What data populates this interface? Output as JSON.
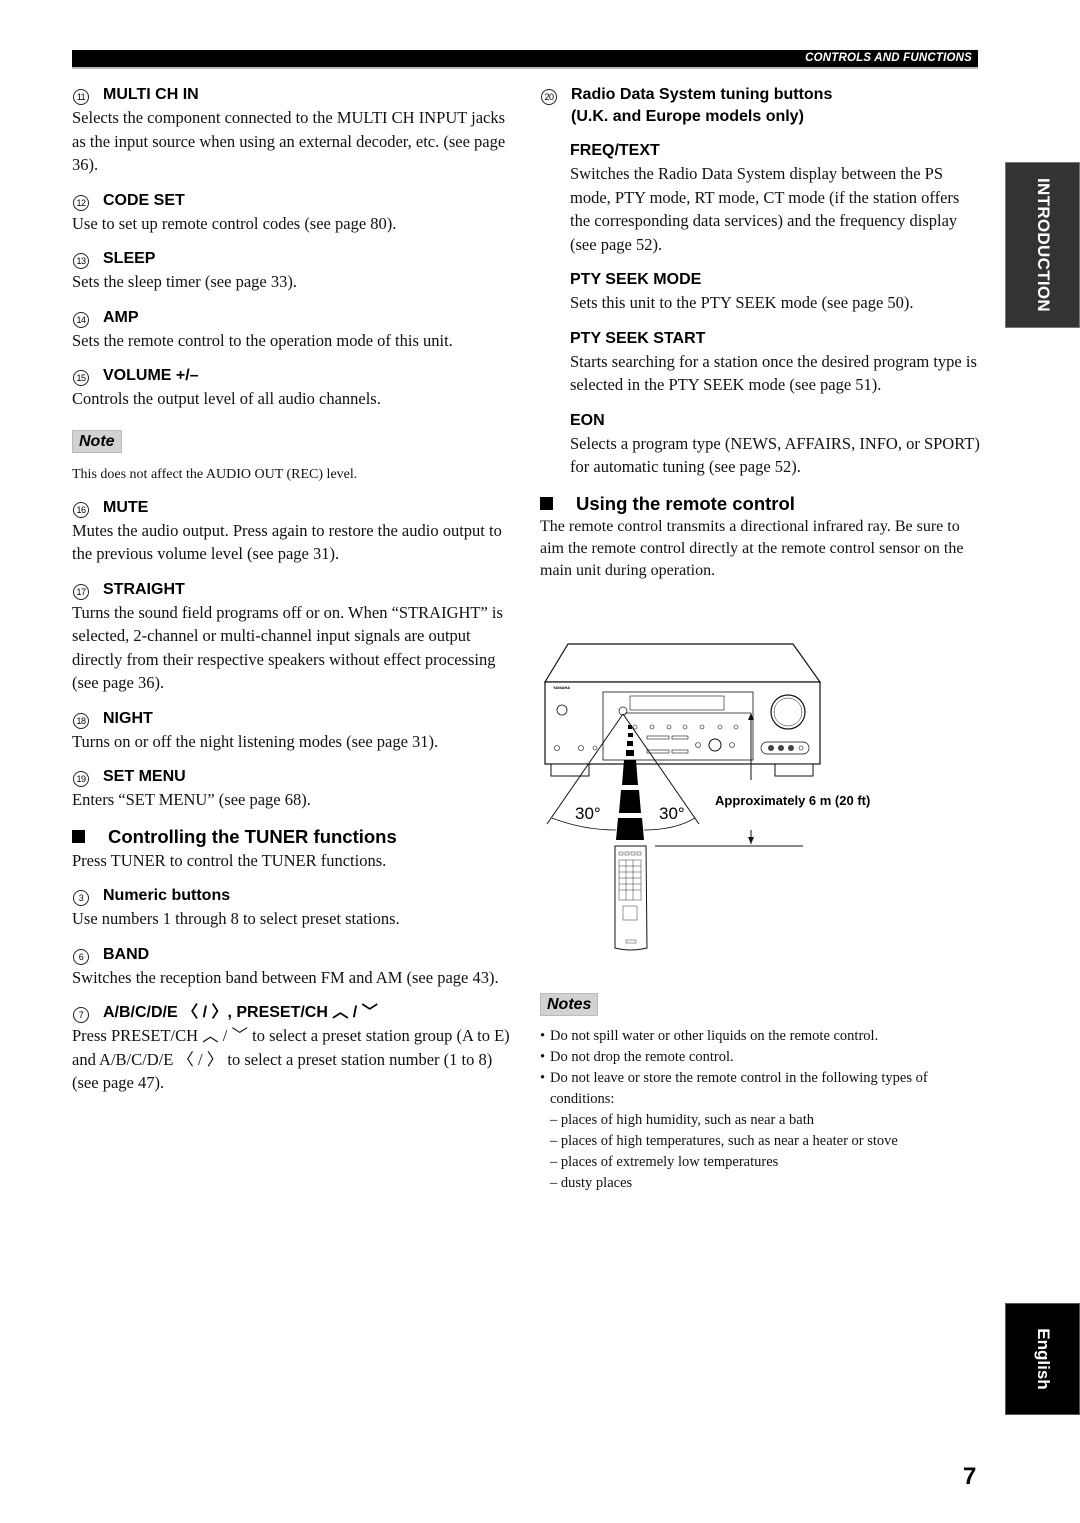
{
  "header": {
    "section_label": "CONTROLS AND FUNCTIONS"
  },
  "left_column": {
    "items": [
      {
        "num": "11",
        "title": "MULTI CH IN",
        "desc": "Selects the component connected to the MULTI CH INPUT jacks as the input source when using an external decoder, etc. (see page 36)."
      },
      {
        "num": "12",
        "title": "CODE SET",
        "desc": "Use to set up remote control codes (see page 80)."
      },
      {
        "num": "13",
        "title": "SLEEP",
        "desc": "Sets the sleep timer (see page 33)."
      },
      {
        "num": "14",
        "title": "AMP",
        "desc": "Sets the remote control to the operation mode of this unit."
      },
      {
        "num": "15",
        "title": "VOLUME +/–",
        "desc": "Controls the output level of all audio channels."
      }
    ],
    "note": {
      "label": "Note",
      "text": "This does not affect the AUDIO OUT (REC) level."
    },
    "items2": [
      {
        "num": "16",
        "title": "MUTE",
        "desc": "Mutes the audio output. Press again to restore the audio output to the previous volume level (see page 31)."
      },
      {
        "num": "17",
        "title": "STRAIGHT",
        "desc": "Turns the sound field programs off or on. When “STRAIGHT” is selected, 2-channel or multi-channel input signals are output directly from their respective speakers without effect processing (see page 36)."
      },
      {
        "num": "18",
        "title": "NIGHT",
        "desc": "Turns on or off the night listening modes (see page 31)."
      },
      {
        "num": "19",
        "title": "SET MENU",
        "desc": "Enters “SET MENU” (see page 68)."
      }
    ],
    "tuner_section": {
      "title": "Controlling the TUNER functions",
      "intro": "Press TUNER to control the TUNER functions.",
      "items": [
        {
          "num": "3",
          "title": "Numeric buttons",
          "desc": "Use numbers 1 through 8 to select preset stations."
        },
        {
          "num": "6",
          "title": "BAND",
          "desc": "Switches the reception band between FM and AM (see page 43)."
        },
        {
          "num": "7",
          "title": "A/B/C/D/E 〈 / 〉, PRESET/CH ︿ / ﹀",
          "desc": "Press PRESET/CH ︿ / ﹀ to select a preset station group (A to E) and A/B/C/D/E 〈 / 〉 to select a preset station number (1 to 8) (see page 47)."
        }
      ]
    }
  },
  "right_column": {
    "rds": {
      "num": "20",
      "title_line1": "Radio Data System tuning buttons",
      "title_line2": "(U.K. and Europe models only)",
      "subitems": [
        {
          "title": "FREQ/TEXT",
          "desc": "Switches the Radio Data System display between the PS mode, PTY mode, RT mode, CT mode (if the station offers the corresponding data services) and the frequency display (see page 52)."
        },
        {
          "title": "PTY SEEK MODE",
          "desc": "Sets this unit to the PTY SEEK mode (see page 50)."
        },
        {
          "title": "PTY SEEK START",
          "desc": "Starts searching for a station once the desired program type is selected in the PTY SEEK mode (see page 51)."
        },
        {
          "title": "EON",
          "desc": "Selects a program type (NEWS, AFFAIRS, INFO, or SPORT) for automatic tuning (see page 52)."
        }
      ]
    },
    "remote_section": {
      "title": "Using the remote control",
      "intro": "The remote control transmits a directional infrared ray. Be sure to aim the remote control directly at the remote control sensor on the main unit during operation."
    },
    "figure": {
      "brand": "YAMAHA",
      "angle_left": "30°",
      "angle_right": "30°",
      "distance_label": "Approximately 6 m (20 ft)"
    },
    "notes": {
      "label": "Notes",
      "bullets": [
        "Do not spill water or other liquids on the remote control.",
        "Do not drop the remote control.",
        "Do not leave or store the remote control in the following types of conditions:"
      ],
      "conditions": [
        "– places of high humidity, such as near a bath",
        "– places of high temperatures, such as near a heater or stove",
        "– places of extremely low temperatures",
        "– dusty places"
      ]
    }
  },
  "side_tabs": {
    "section": "INTRODUCTION",
    "language": "English"
  },
  "footer": {
    "page_number": "7"
  }
}
